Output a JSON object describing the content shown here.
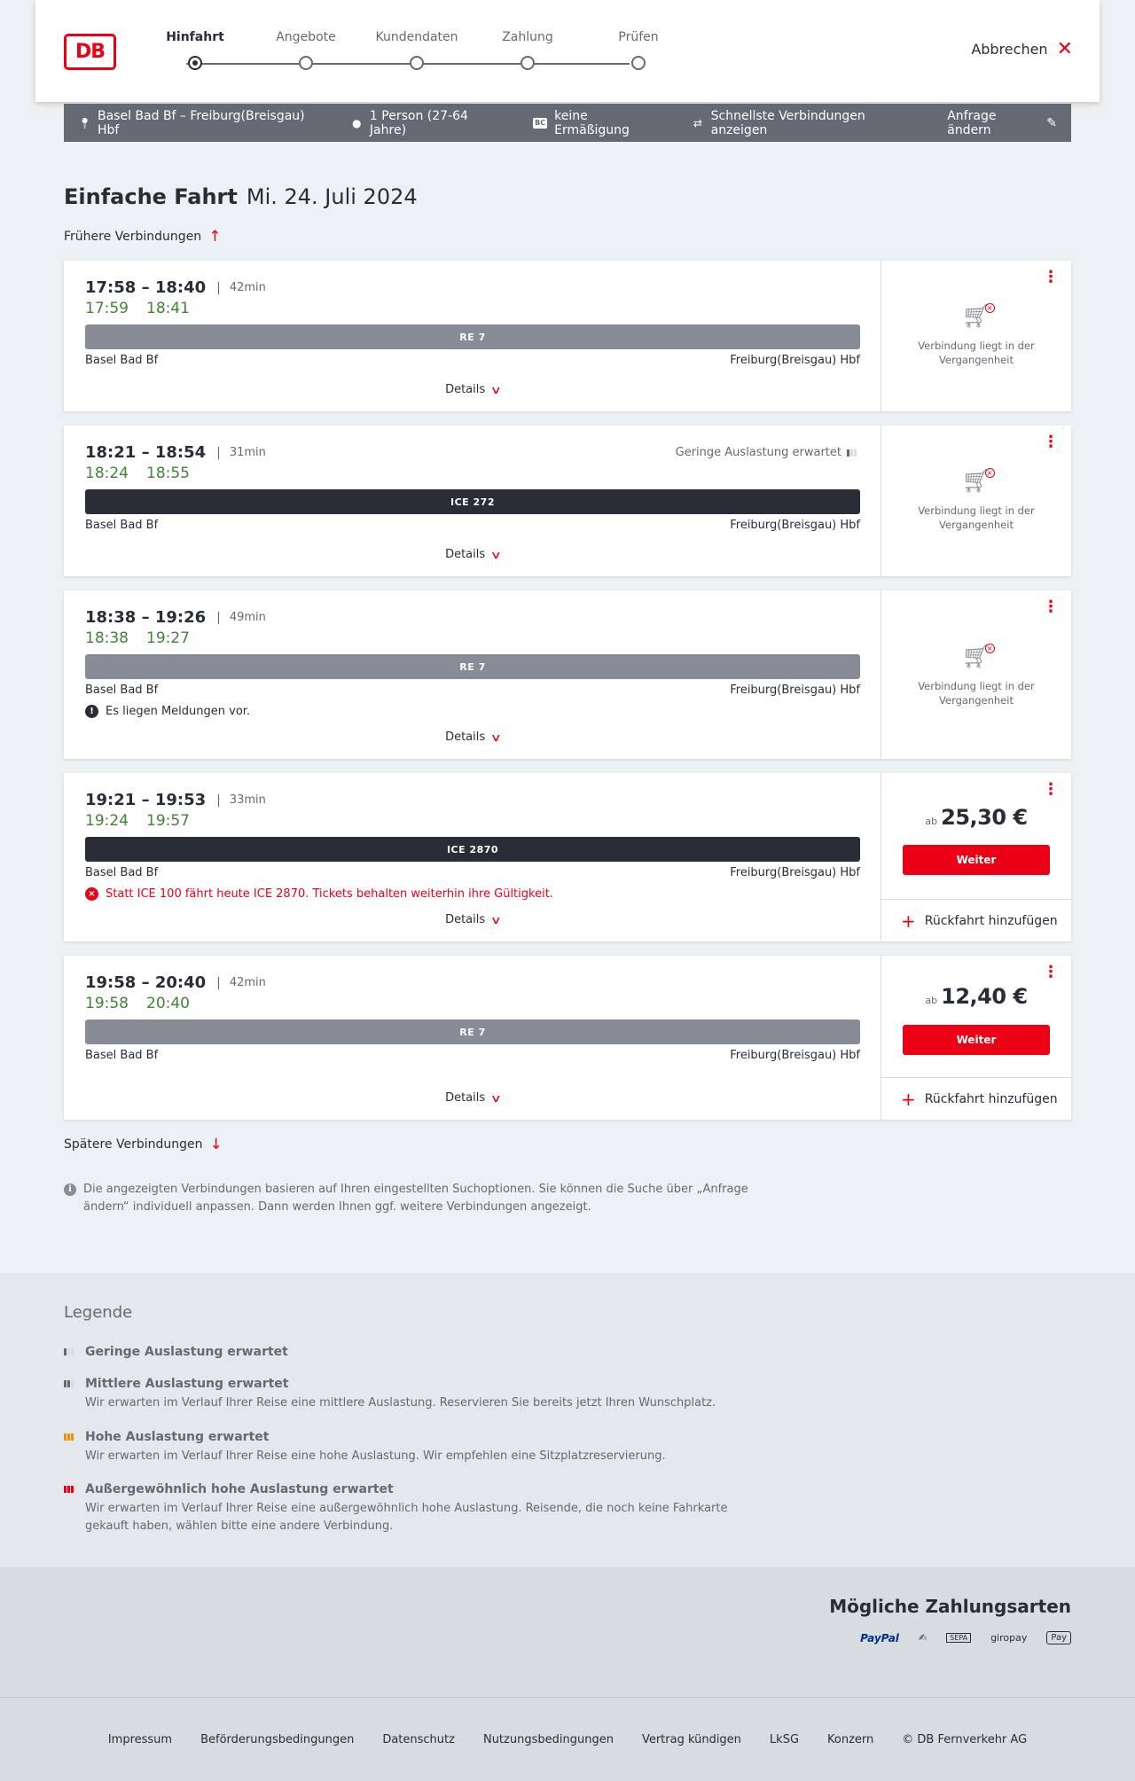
{
  "header": {
    "logo": "DB",
    "steps": [
      {
        "label": "Hinfahrt",
        "active": true
      },
      {
        "label": "Angebote",
        "active": false
      },
      {
        "label": "Kundendaten",
        "active": false
      },
      {
        "label": "Zahlung",
        "active": false
      },
      {
        "label": "Prüfen",
        "active": false
      }
    ],
    "cancel_label": "Abbrechen"
  },
  "search": {
    "route": "Basel Bad Bf – Freiburg(Breisgau) Hbf",
    "travellers": "1 Person (27-64 Jahre)",
    "discount_badge": "BC",
    "discount": "keine Ermäßigung",
    "fastest": "Schnellste Verbindungen anzeigen",
    "change_label": "Anfrage ändern"
  },
  "page": {
    "title": "Einfache Fahrt",
    "date": "Mi. 24. Juli 2024",
    "earlier_label": "Frühere Verbindungen",
    "later_label": "Spätere Verbindungen",
    "info_text": "Die angezeigten Verbindungen basieren auf Ihren eingestellten Suchoptionen. Sie können die Suche über „Anfrage ändern“ individuell anpassen. Dann werden Ihnen ggf. weitere Verbindungen angezeigt."
  },
  "connections": [
    {
      "times": "17:58 – 18:40",
      "duration": "42min",
      "rt_dep": "17:59",
      "rt_arr": "18:41",
      "train": "RE 7",
      "train_type": "re",
      "from": "Basel Bad Bf",
      "to": "Freiburg(Breisgau) Hbf",
      "details_label": "Details",
      "past_text": "Verbindung liegt in der Vergangenheit"
    },
    {
      "times": "18:21 – 18:54",
      "duration": "31min",
      "rt_dep": "18:24",
      "rt_arr": "18:55",
      "load_note": "Geringe Auslastung erwartet",
      "train": "ICE 272",
      "train_type": "ice",
      "from": "Basel Bad Bf",
      "to": "Freiburg(Breisgau) Hbf",
      "details_label": "Details",
      "past_text": "Verbindung liegt in der Vergangenheit"
    },
    {
      "times": "18:38 – 19:26",
      "duration": "49min",
      "rt_dep": "18:38",
      "rt_arr": "19:27",
      "train": "RE 7",
      "train_type": "re",
      "from": "Basel Bad Bf",
      "to": "Freiburg(Breisgau) Hbf",
      "message": "Es liegen Meldungen vor.",
      "details_label": "Details",
      "past_text": "Verbindung liegt in der Vergangenheit"
    },
    {
      "times": "19:21 – 19:53",
      "duration": "33min",
      "rt_dep": "19:24",
      "rt_arr": "19:57",
      "train": "ICE 2870",
      "train_type": "ice",
      "from": "Basel Bad Bf",
      "to": "Freiburg(Breisgau) Hbf",
      "error": "Statt ICE 100 fährt heute ICE 2870. Tickets behalten weiterhin ihre Gültigkeit.",
      "details_label": "Details",
      "price_prefix": "ab",
      "price": "25,30 €",
      "button_label": "Weiter",
      "return_label": "Rückfahrt hinzufügen"
    },
    {
      "times": "19:58 – 20:40",
      "duration": "42min",
      "rt_dep": "19:58",
      "rt_arr": "20:40",
      "train": "RE 7",
      "train_type": "re",
      "from": "Basel Bad Bf",
      "to": "Freiburg(Breisgau) Hbf",
      "details_label": "Details",
      "price_prefix": "ab",
      "price": "12,40 €",
      "button_label": "Weiter",
      "return_label": "Rückfahrt hinzufügen"
    }
  ],
  "legend": {
    "title": "Legende",
    "items": [
      {
        "title": "Geringe Auslastung erwartet",
        "text": ""
      },
      {
        "title": "Mittlere Auslastung erwartet",
        "text": "Wir erwarten im Verlauf Ihrer Reise eine mittlere Auslastung. Reservieren Sie bereits jetzt Ihren Wunschplatz."
      },
      {
        "title": "Hohe Auslastung erwartet",
        "text": "Wir erwarten im Verlauf Ihrer Reise eine hohe Auslastung. Wir empfehlen eine Sitzplatzreservierung."
      },
      {
        "title": "Außergewöhnlich hohe Auslastung erwartet",
        "text": "Wir erwarten im Verlauf Ihrer Reise eine außergewöhnlich hohe Auslastung. Reisende, die noch keine Fahrkarte gekauft haben, wählen bitte eine andere Verbindung."
      }
    ]
  },
  "payment": {
    "title": "Mögliche Zahlungsarten",
    "icons": {
      "paypal": "PayPal",
      "sepa": "SEPA",
      "giropay": "giropay",
      "applepay": "Pay"
    }
  },
  "footer": {
    "links": [
      "Impressum",
      "Beförderungsbedingungen",
      "Datenschutz",
      "Nutzungsbedingungen",
      "Vertrag kündigen",
      "LkSG",
      "Konzern"
    ],
    "copyright": "© DB Fernverkehr AG"
  },
  "colors": {
    "accent": "#ec0016",
    "realtime": "#408335",
    "dark": "#282d37"
  }
}
